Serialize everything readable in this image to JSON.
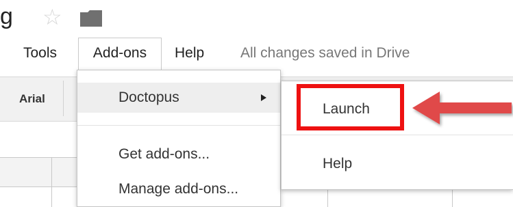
{
  "doc": {
    "title_fragment": "g",
    "star_icon": "star-icon",
    "folder_icon": "folder-icon"
  },
  "menubar": {
    "items": [
      {
        "label": "Tools"
      },
      {
        "label": "Add-ons"
      },
      {
        "label": "Help"
      }
    ],
    "save_status": "All changes saved in Drive"
  },
  "toolbar": {
    "font": "Arial"
  },
  "addons_menu": {
    "items": [
      {
        "label": "Doctopus",
        "has_submenu": true
      },
      {
        "label": "Get add-ons..."
      },
      {
        "label": "Manage add-ons..."
      }
    ]
  },
  "doctopus_submenu": {
    "items": [
      {
        "label": "Launch"
      },
      {
        "label": "Help"
      }
    ]
  },
  "annotation": {
    "highlight_color": "#ee1111",
    "arrow_color": "#e04a4a"
  }
}
